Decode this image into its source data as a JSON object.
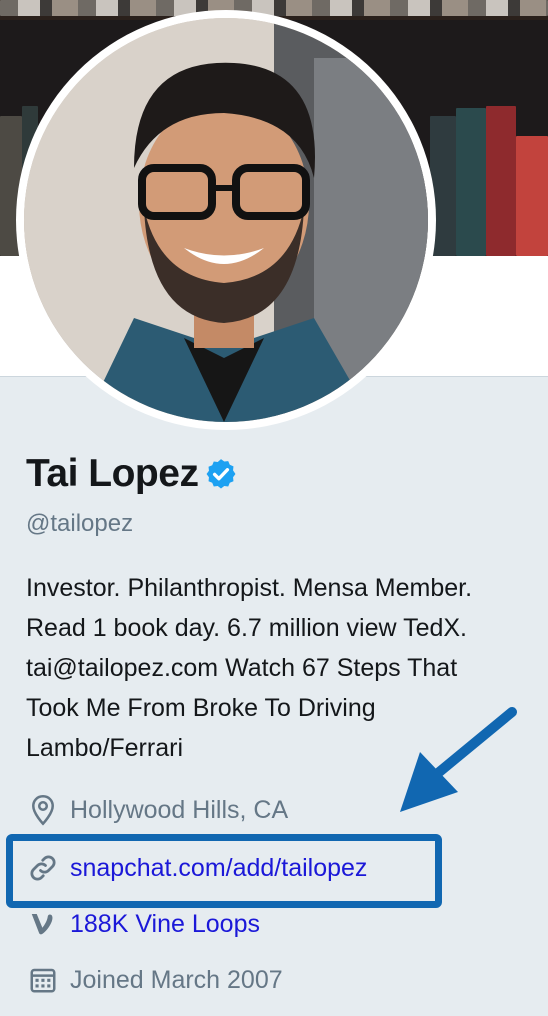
{
  "profile": {
    "name": "Tai Lopez",
    "handle": "@tailopez",
    "bio_lines": [
      "Investor. Philanthropist. Mensa Member.",
      "Read 1 book day. 6.7 million view TedX.",
      "tai@tailopez.com Watch 67 Steps That",
      "Took Me From Broke To Driving",
      "Lambo/Ferrari"
    ],
    "location": "Hollywood Hills, CA",
    "website": "snapchat.com/add/tailopez",
    "vine": "188K Vine Loops",
    "joined": "Joined March 2007"
  },
  "icons": {
    "verified": "verified-badge-icon",
    "location": "location-pin-icon",
    "website": "link-icon",
    "vine": "vine-icon",
    "joined": "calendar-icon"
  },
  "colors": {
    "panel_bg": "#e6ecf0",
    "link": "#1b18d8",
    "muted": "#657786",
    "verified": "#1da1f2",
    "annotation": "#1167b1"
  }
}
